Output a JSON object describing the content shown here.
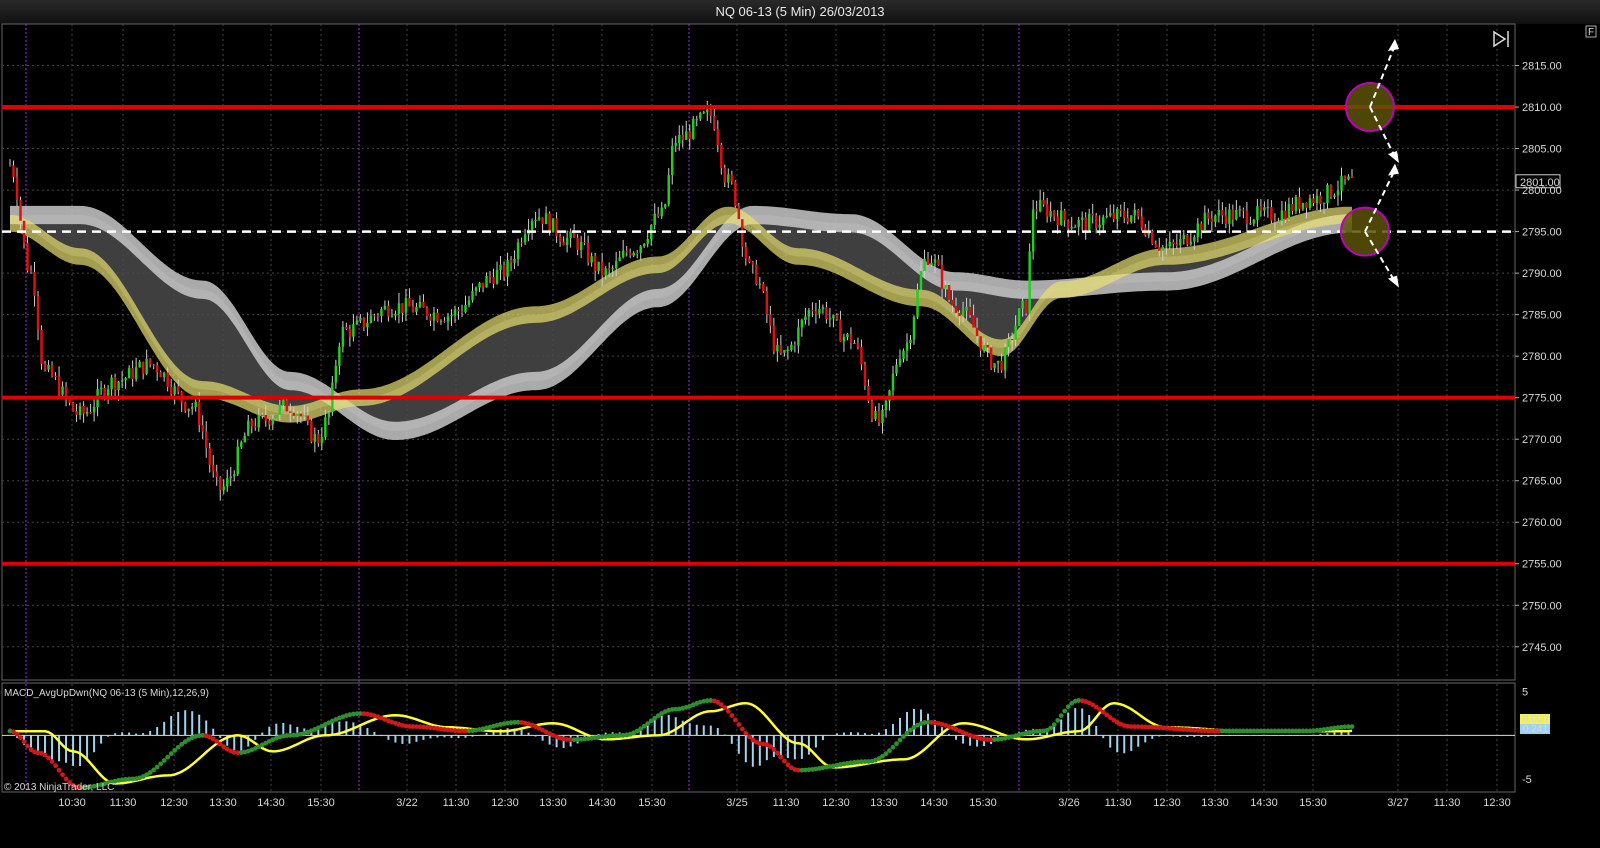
{
  "window": {
    "title": "NQ 06-13 (5 Min)  26/03/2013",
    "corner_label": "F"
  },
  "colors": {
    "background": "#000000",
    "up_candle": "#1fd11f",
    "down_candle": "#e01010",
    "wick": "#d0d0d0",
    "level_line": "#e00000",
    "pivot_line": "#ffffff",
    "ribbon_fast": "#e8e070",
    "ribbon_slow": "#c8c8c8",
    "circle": "#c000c0",
    "macd_up": "#2d8f2d",
    "macd_down": "#d01818",
    "signal": "#ffff33",
    "histogram": "#9fd3f0",
    "session_divider": "#9933cc",
    "grid": "#444444"
  },
  "chart_data": {
    "type": "candlestick",
    "instrument": "NQ 06-13",
    "interval": "5 Min",
    "date": "26/03/2013",
    "ylim": [
      2741,
      2820
    ],
    "y_ticks": [
      "2815.00",
      "2810.00",
      "2805.00",
      "2800.00",
      "2795.00",
      "2790.00",
      "2785.00",
      "2780.00",
      "2775.00",
      "2770.00",
      "2765.00",
      "2760.00",
      "2755.00",
      "2750.00",
      "2745.00"
    ],
    "x_ticks": [
      "10:30",
      "11:30",
      "12:30",
      "13:30",
      "14:30",
      "15:30",
      "3/22",
      "11:30",
      "12:30",
      "13:30",
      "14:30",
      "15:30",
      "3/25",
      "11:30",
      "12:30",
      "13:30",
      "14:30",
      "15:30",
      "3/26",
      "11:30",
      "12:30",
      "13:30",
      "14:30",
      "15:30",
      "3/27",
      "11:30",
      "12:30"
    ],
    "price_anchors": [
      [
        0,
        2803
      ],
      [
        6,
        2790
      ],
      [
        10,
        2778
      ],
      [
        20,
        2773
      ],
      [
        30,
        2777
      ],
      [
        40,
        2779
      ],
      [
        52,
        2774
      ],
      [
        60,
        2764
      ],
      [
        70,
        2772
      ],
      [
        80,
        2774
      ],
      [
        88,
        2770
      ],
      [
        90,
        2772
      ],
      [
        95,
        2783
      ],
      [
        110,
        2786
      ],
      [
        125,
        2785
      ],
      [
        140,
        2790
      ],
      [
        150,
        2797
      ],
      [
        160,
        2794
      ],
      [
        170,
        2790
      ],
      [
        178,
        2793
      ],
      [
        186,
        2797
      ],
      [
        190,
        2806
      ],
      [
        200,
        2809
      ],
      [
        205,
        2801
      ],
      [
        212,
        2790
      ],
      [
        220,
        2780
      ],
      [
        230,
        2786
      ],
      [
        240,
        2782
      ],
      [
        248,
        2772
      ],
      [
        255,
        2781
      ],
      [
        262,
        2792
      ],
      [
        270,
        2786
      ],
      [
        282,
        2779
      ],
      [
        290,
        2786
      ],
      [
        292,
        2798
      ],
      [
        305,
        2796
      ],
      [
        320,
        2797
      ],
      [
        330,
        2793
      ],
      [
        345,
        2797
      ],
      [
        360,
        2797
      ],
      [
        372,
        2799
      ],
      [
        383,
        2801
      ]
    ],
    "fast_ribbon_anchors": [
      [
        0,
        2796
      ],
      [
        20,
        2792
      ],
      [
        55,
        2776
      ],
      [
        80,
        2773
      ],
      [
        100,
        2775
      ],
      [
        150,
        2785
      ],
      [
        185,
        2791
      ],
      [
        205,
        2797
      ],
      [
        225,
        2792
      ],
      [
        260,
        2787
      ],
      [
        283,
        2781
      ],
      [
        300,
        2788
      ],
      [
        330,
        2792
      ],
      [
        383,
        2797
      ]
    ],
    "slow_ribbon_anchors": [
      [
        0,
        2797
      ],
      [
        20,
        2797
      ],
      [
        55,
        2788
      ],
      [
        80,
        2777
      ],
      [
        110,
        2771
      ],
      [
        150,
        2777
      ],
      [
        185,
        2787
      ],
      [
        212,
        2797
      ],
      [
        240,
        2796
      ],
      [
        270,
        2789
      ],
      [
        290,
        2788
      ],
      [
        330,
        2789
      ],
      [
        383,
        2796
      ]
    ],
    "horizontal_levels": [
      {
        "price": 2810,
        "style": "solid"
      },
      {
        "price": 2795,
        "style": "dashed"
      },
      {
        "price": 2775,
        "style": "solid"
      },
      {
        "price": 2755,
        "style": "solid"
      }
    ],
    "annotations": {
      "circles": [
        {
          "price": 2810
        },
        {
          "price": 2795
        }
      ],
      "current_price": "2801.00"
    },
    "indicator": {
      "label": "MACD_AvgUpDwn(NQ 06-13 (5 Min),12,26,9)",
      "y_ticks": [
        "5",
        "-5"
      ],
      "ylim": [
        -6.5,
        6
      ],
      "macd_value": "0.000",
      "signal_value": "0.241",
      "macd_anchors": [
        [
          0,
          0.5
        ],
        [
          8,
          -2
        ],
        [
          20,
          -6
        ],
        [
          35,
          -5
        ],
        [
          55,
          0
        ],
        [
          65,
          -2
        ],
        [
          80,
          0
        ],
        [
          100,
          2.5
        ],
        [
          115,
          1
        ],
        [
          130,
          0.5
        ],
        [
          145,
          1.5
        ],
        [
          160,
          -0.5
        ],
        [
          175,
          0
        ],
        [
          190,
          3
        ],
        [
          200,
          4
        ],
        [
          215,
          -1
        ],
        [
          225,
          -4
        ],
        [
          245,
          -3
        ],
        [
          262,
          1.5
        ],
        [
          280,
          -0.5
        ],
        [
          295,
          0.5
        ],
        [
          305,
          4
        ],
        [
          320,
          1
        ],
        [
          345,
          0.5
        ],
        [
          370,
          0.5
        ],
        [
          383,
          1
        ]
      ]
    },
    "copyright": "© 2013 NinjaTrader, LLC"
  }
}
